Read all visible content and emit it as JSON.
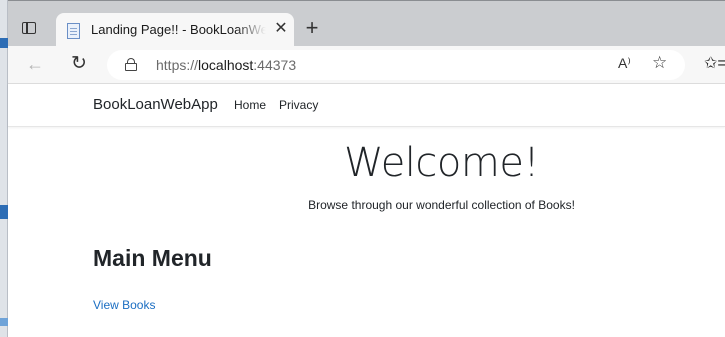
{
  "browser": {
    "tab": {
      "title": "Landing Page!! - BookLoanWebApp",
      "close_glyph": "✕"
    },
    "new_tab_glyph": "+",
    "address": {
      "scheme": "https://",
      "host": "localhost",
      "port": ":44373"
    },
    "read_aloud_glyph": "A⁾",
    "favorites_glyph": "☆",
    "collections_glyph": "✩="
  },
  "site": {
    "brand": "BookLoanWebApp",
    "nav": [
      {
        "label": "Home"
      },
      {
        "label": "Privacy"
      }
    ]
  },
  "main": {
    "heading": "Welcome!",
    "tagline": "Browse through our wonderful collection of Books!",
    "menu_title": "Main Menu",
    "link_label": "View Books"
  },
  "colors": {
    "link": "#1b6ec2",
    "text": "#212529",
    "tab_strip": "#cbcdd0"
  }
}
